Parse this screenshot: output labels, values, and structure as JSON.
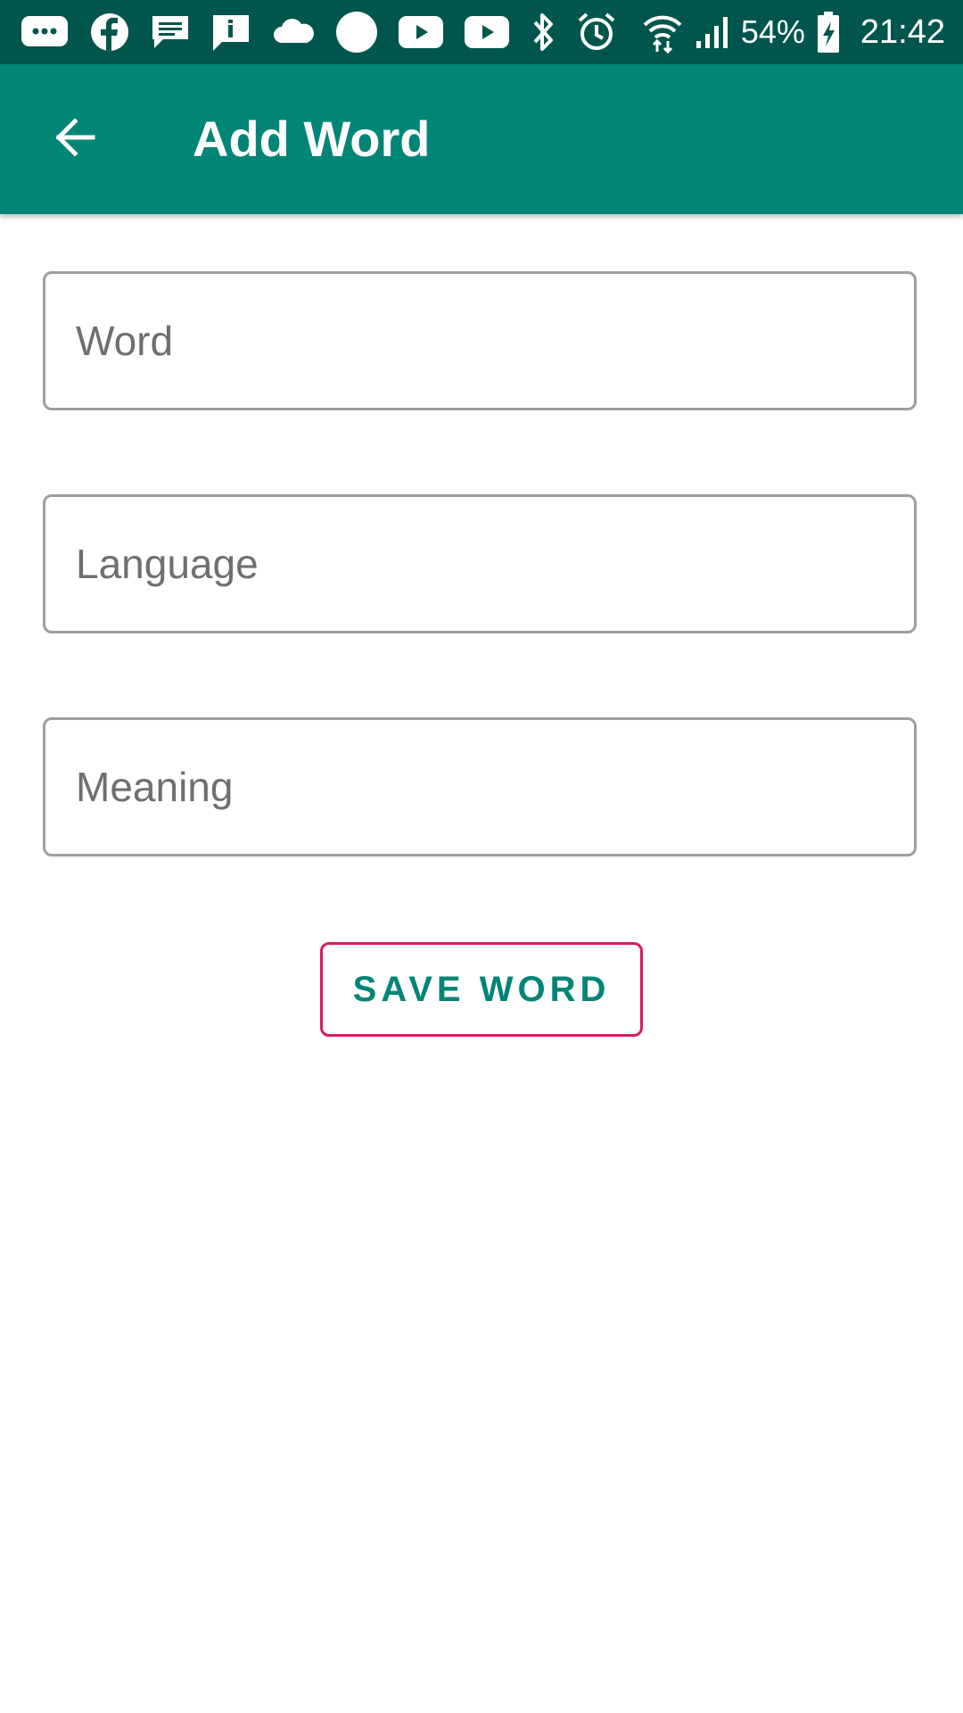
{
  "status_bar": {
    "icons": [
      "messenger-icon",
      "facebook-icon",
      "message-icon",
      "info-message-icon",
      "cloud-icon",
      "circle-icon",
      "youtube-icon",
      "youtube-icon",
      "bluetooth-icon",
      "alarm-icon",
      "wifi-icon",
      "signal-icon",
      "battery-charging-icon"
    ],
    "battery": "54%",
    "time": "21:42"
  },
  "app_bar": {
    "title": "Add Word",
    "back_icon": "arrow-back-icon"
  },
  "form": {
    "word_placeholder": "Word",
    "language_placeholder": "Language",
    "meaning_placeholder": "Meaning",
    "save_label": "SAVE WORD"
  },
  "colors": {
    "status_bar": "#00564c",
    "primary": "#018577",
    "accent_border": "#d81b60",
    "field_border": "#9e9e9e"
  }
}
